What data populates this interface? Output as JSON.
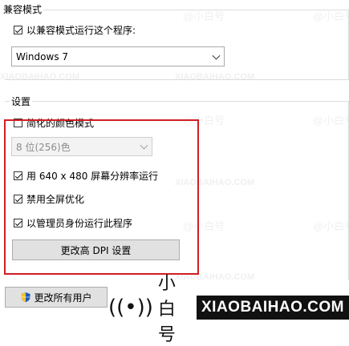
{
  "compat_group": {
    "title": "兼容模式",
    "checkbox_label": "以兼容模式运行这个程序:",
    "checkbox_checked": true,
    "os_select_value": "Windows 7"
  },
  "settings_group": {
    "title": "设置",
    "reduced_color": {
      "label": "简化的颜色模式",
      "checked": false
    },
    "color_select_value": "8 位(256)色",
    "run_640": {
      "label": "用 640 x 480 屏幕分辨率运行",
      "checked": true
    },
    "disable_fullscreen": {
      "label": "禁用全屏优化",
      "checked": true
    },
    "run_as_admin": {
      "label": "以管理员身份运行此程序",
      "checked": true
    },
    "dpi_button_label": "更改高 DPI 设置"
  },
  "change_all_users_label": "更改所有用户",
  "watermark": {
    "cn": "@小白号",
    "en": "XIAOBAIHAO.COM",
    "brand_cn": "小白号",
    "brand_en": "XIAOBAIHAO.COM"
  },
  "colors": {
    "highlight": "#d21d23"
  }
}
